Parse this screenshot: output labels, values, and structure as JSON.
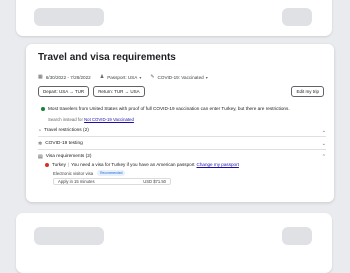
{
  "card": {
    "title": "Travel and visa requirements",
    "filters": [
      {
        "icon": "calendar-icon",
        "label": "6/30/2022 - 7/28/2022"
      },
      {
        "icon": "passport-icon",
        "label": "Passport: USA"
      },
      {
        "icon": "syringe-icon",
        "label": "COVID-19: Vaccinated"
      }
    ],
    "route": {
      "depart": "Depart: USA → TUR",
      "return": "Return: TUR → USA"
    },
    "edit_trip": "Edit my trip",
    "notice": "Most travelers from United States with proof of full COVID-19 vaccination can enter Turkey, but there are restrictions.",
    "search_prefix": "Search instead for",
    "search_link": "Not COVID-19 Vaccinated",
    "sections": [
      {
        "icon": "clock-icon",
        "label": "Travel restrictions (2)",
        "expanded": false
      },
      {
        "icon": "virus-icon",
        "label": "COVID-19 testing",
        "expanded": false
      },
      {
        "icon": "document-icon",
        "label": "Visa requirements (2)",
        "expanded": true
      }
    ],
    "visa": {
      "country": "Turkey",
      "message": "You need a visa for Turkey if you have an American passport",
      "change_link": "Change my passport",
      "type_label": "Electronic visitor visa",
      "badge": "Recommended",
      "apply_label": "Apply in 15 minutes",
      "price": "USD $71.50"
    }
  }
}
